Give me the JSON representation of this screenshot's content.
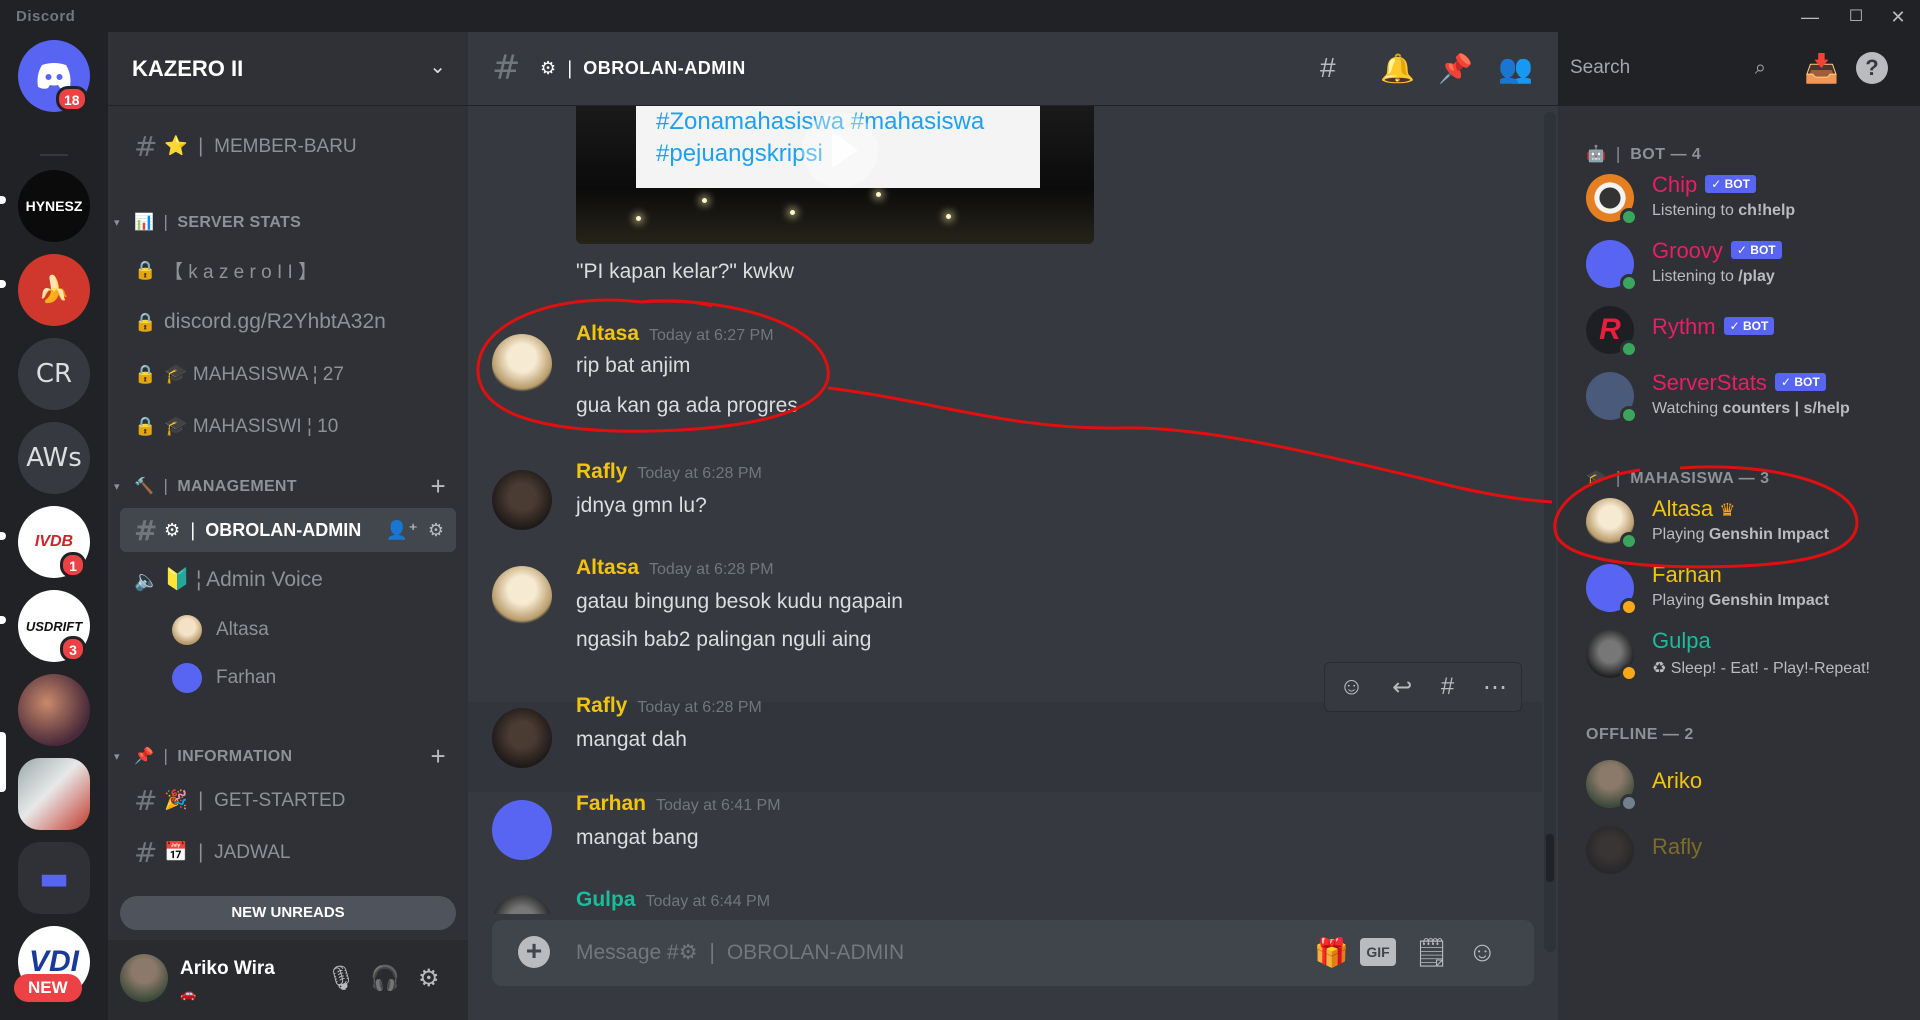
{
  "window": {
    "app_name": "Discord",
    "minimize": "—",
    "maximize": "☐",
    "close": "✕"
  },
  "rail": {
    "home_badge": "18",
    "servers": [
      {
        "label": "HYNESZ"
      },
      {
        "label": "🍌"
      },
      {
        "label": "CR"
      },
      {
        "label": "AWs"
      },
      {
        "label": "IVDB",
        "badge": "1"
      },
      {
        "label": "USDRIFT",
        "badge": "3"
      },
      {
        "label": ""
      },
      {
        "label": ""
      },
      {
        "label": "VDI"
      }
    ],
    "new_label": "NEW"
  },
  "sidebar": {
    "guild_name": "KAZERO II",
    "channels_top": [
      {
        "icon": "#",
        "label": "⭐ ❘ MEMBER-BARU"
      }
    ],
    "server_stats": {
      "title": "📊 ❘ SERVER STATS",
      "items": [
        {
          "label": "【 k a z e r o   I I 】"
        },
        {
          "label": "discord.gg/R2YhbtA32n"
        },
        {
          "label": "🎓 MAHASISWA ¦ 27"
        },
        {
          "label": "🎓 MAHASISWI ¦ 10"
        }
      ]
    },
    "management": {
      "title": "🔨 ❘ MANAGEMENT",
      "active_channel": "⚙ ❘ OBROLAN-ADMIN",
      "voice_channel": "🔰 ¦ Admin Voice",
      "voice_users": [
        "Altasa",
        "Farhan"
      ]
    },
    "information": {
      "title": "📌 ❘ INFORMATION",
      "items": [
        {
          "label": "🎉 ❘ GET-STARTED"
        },
        {
          "label": "📅 ❘ JADWAL"
        }
      ]
    },
    "new_unreads": "NEW UNREADS",
    "user": {
      "name": "Ariko Wira",
      "status": "🚗"
    }
  },
  "chat": {
    "channel_title": "⚙ ❘ OBROLAN-ADMIN",
    "search_placeholder": "Search",
    "video_card_text": [
      "#Zonamahasiswa #mahasiswa",
      "#pejuangskripsi"
    ],
    "caption": "\"PI kapan kelar?\" kwkw",
    "messages": [
      {
        "author": "Altasa",
        "time": "Today at 6:27 PM",
        "color": "#f1c40f",
        "lines": [
          "rip bat anjim",
          "gua kan ga ada progres"
        ]
      },
      {
        "author": "Rafly",
        "time": "Today at 6:28 PM",
        "color": "#f1c40f",
        "lines": [
          "jdnya gmn lu?"
        ]
      },
      {
        "author": "Altasa",
        "time": "Today at 6:28 PM",
        "color": "#f1c40f",
        "lines": [
          "gatau bingung besok kudu ngapain",
          "ngasih bab2 palingan nguli aing"
        ]
      },
      {
        "author": "Rafly",
        "time": "Today at 6:28 PM",
        "color": "#f1c40f",
        "lines": [
          "mangat dah"
        ]
      },
      {
        "author": "Farhan",
        "time": "Today at 6:41 PM",
        "color": "#f1c40f",
        "lines": [
          "mangat bang"
        ]
      },
      {
        "author": "Gulpa",
        "time": "Today at 6:44 PM",
        "color": "#1abc9c",
        "lines": []
      }
    ],
    "composer_placeholder": "Message #⚙ ❘ OBROLAN-ADMIN",
    "gif_label": "GIF"
  },
  "members": {
    "bot_group": "🤖 ❘ BOT — 4",
    "bot_tag": "✓ BOT",
    "bots": [
      {
        "name": "Chip",
        "color": "#e91e63",
        "activity_prefix": "Listening to ",
        "activity_bold": "ch!help"
      },
      {
        "name": "Groovy",
        "color": "#e91e63",
        "activity_prefix": "Listening to ",
        "activity_bold": "/play"
      },
      {
        "name": "Rythm",
        "color": "#e91e63",
        "activity_prefix": "",
        "activity_bold": ""
      },
      {
        "name": "ServerStats",
        "color": "#e91e63",
        "activity_prefix": "Watching ",
        "activity_bold": "counters | s/help"
      }
    ],
    "mhs_group": "🎓 ❘ MAHASISWA — 3",
    "mahasiswa": [
      {
        "name": "Altasa",
        "crown": "♛",
        "color": "#f1c40f",
        "activity_prefix": "Playing ",
        "activity_bold": "Genshin Impact"
      },
      {
        "name": "Farhan",
        "color": "#f1c40f",
        "activity_prefix": "Playing ",
        "activity_bold": "Genshin Impact"
      },
      {
        "name": "Gulpa",
        "color": "#1abc9c",
        "activity_prefix": "♻ Sleep! - Eat! - Play!-Repeat!",
        "activity_bold": ""
      }
    ],
    "offline_group": "OFFLINE — 2",
    "offline": [
      {
        "name": "Ariko",
        "color": "#f1c40f"
      },
      {
        "name": "Rafly",
        "color": "#f1c40f"
      }
    ]
  },
  "colors": {
    "accent": "#5865f2",
    "annotation": "#e01010",
    "online": "#3ba55d",
    "idle": "#faa81a"
  }
}
